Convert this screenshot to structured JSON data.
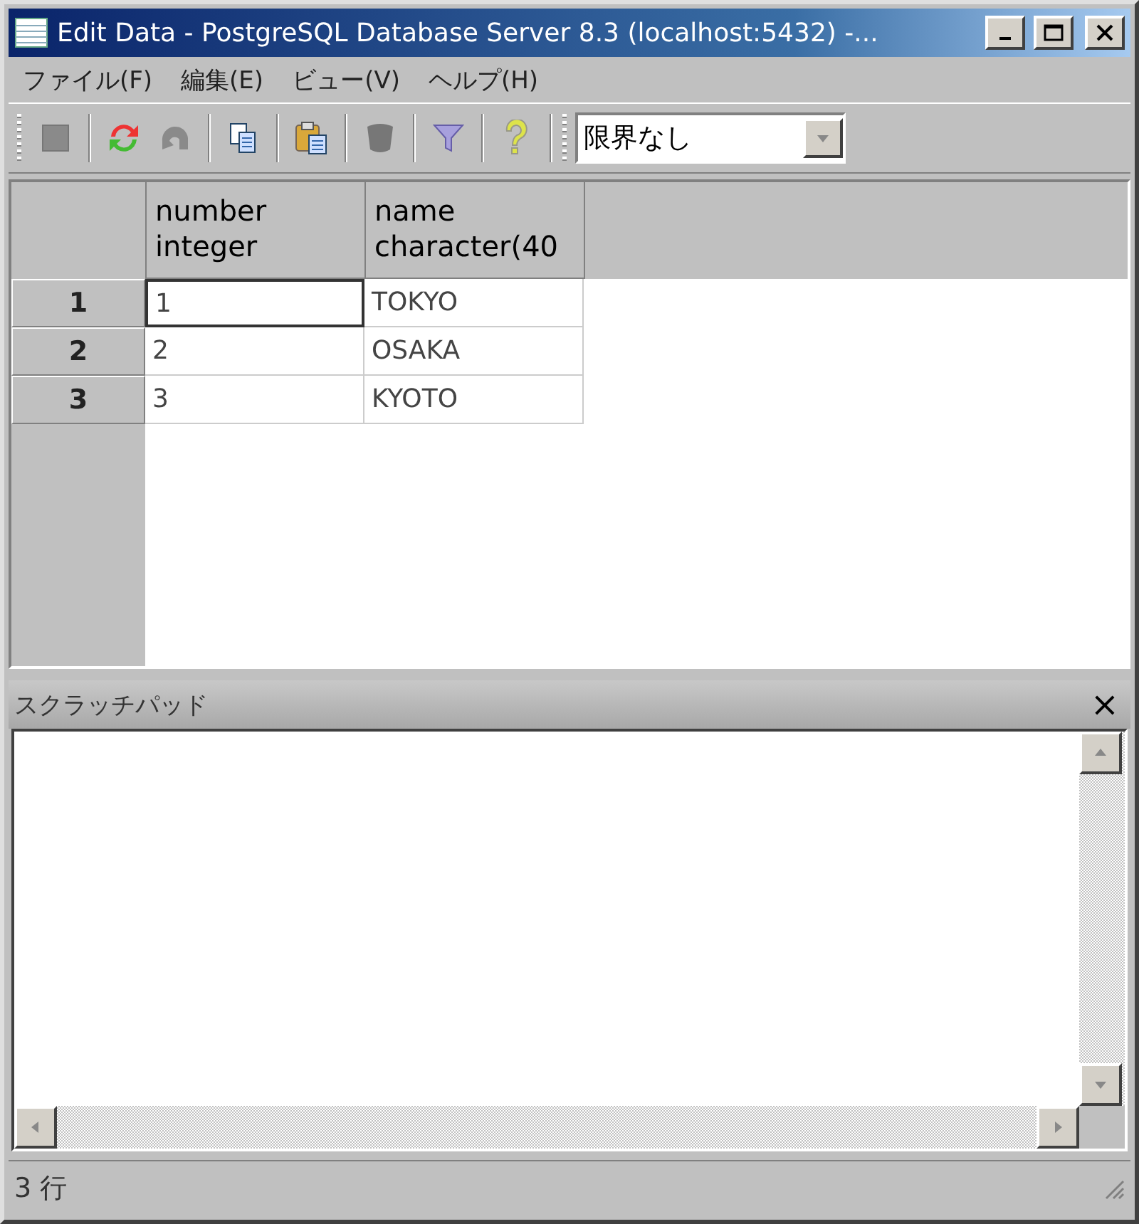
{
  "window": {
    "title": "Edit Data - PostgreSQL Database Server 8.3 (localhost:5432) -..."
  },
  "menu": [
    {
      "label": "ファイル(F)"
    },
    {
      "label": "編集(E)"
    },
    {
      "label": "ビュー(V)"
    },
    {
      "label": "ヘルプ(H)"
    }
  ],
  "toolbar": {
    "groups": [
      [
        {
          "kind": "stop",
          "disabled": true
        }
      ],
      [
        {
          "kind": "refresh",
          "disabled": false
        },
        {
          "kind": "undo",
          "disabled": true
        }
      ],
      [
        {
          "kind": "copy",
          "disabled": false
        }
      ],
      [
        {
          "kind": "paste",
          "disabled": false
        }
      ],
      [
        {
          "kind": "delete",
          "disabled": true
        }
      ],
      [
        {
          "kind": "filter",
          "disabled": false
        }
      ],
      [
        {
          "kind": "help",
          "disabled": false
        }
      ]
    ],
    "limit": {
      "value": "限界なし"
    }
  },
  "grid": {
    "columns": [
      {
        "name": "number",
        "type": "integer"
      },
      {
        "name": "name",
        "type": "character(40"
      }
    ],
    "rows": [
      {
        "header": "1",
        "cells": [
          {
            "value": "1",
            "focused": true
          },
          {
            "value": "TOKYO",
            "focused": false
          }
        ]
      },
      {
        "header": "2",
        "cells": [
          {
            "value": "2",
            "focused": false
          },
          {
            "value": "OSAKA",
            "focused": false
          }
        ]
      },
      {
        "header": "3",
        "cells": [
          {
            "value": "3",
            "focused": false
          },
          {
            "value": "KYOTO",
            "focused": false
          }
        ]
      }
    ]
  },
  "scratch_pad": {
    "title": "スクラッチパッド",
    "close": "×"
  },
  "status_bar": {
    "text": "3 行"
  }
}
